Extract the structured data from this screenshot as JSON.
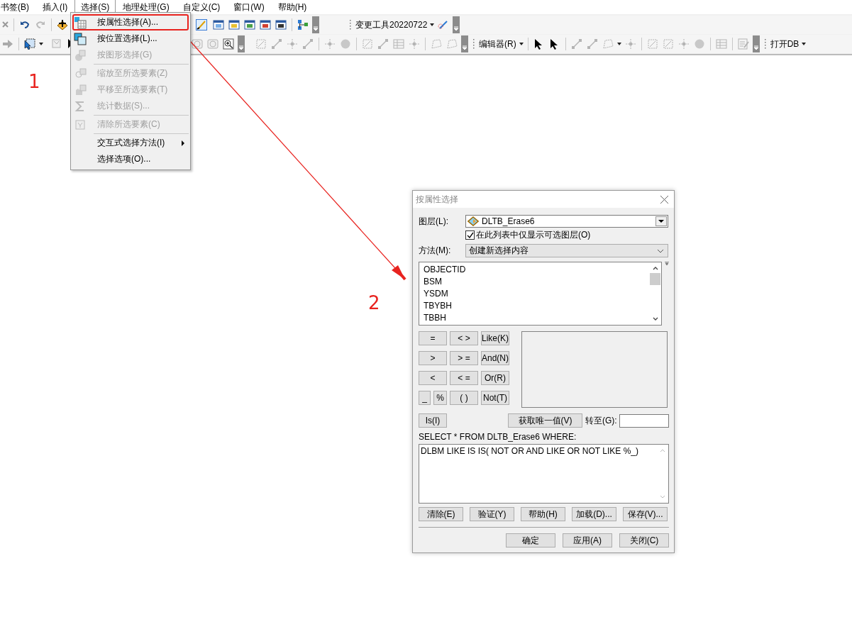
{
  "menubar": [
    {
      "label": "书签(B)",
      "selected": false
    },
    {
      "label": "插入(I)",
      "selected": false
    },
    {
      "label": "选择(S)",
      "selected": true
    },
    {
      "label": "地理处理(G)",
      "selected": false
    },
    {
      "label": "自定义(C)",
      "selected": false
    },
    {
      "label": "窗口(W)",
      "selected": false
    },
    {
      "label": "帮助(H)",
      "selected": false
    }
  ],
  "toolbar": {
    "tool_menu": "变更工具20220722",
    "editor_menu": "编辑器(R)",
    "db_menu": "打开DB"
  },
  "menu": {
    "items": [
      {
        "kind": "item",
        "label": "按属性选择(A)...",
        "disabled": false,
        "highlighted": true
      },
      {
        "kind": "item",
        "label": "按位置选择(L)...",
        "disabled": false,
        "highlighted": false
      },
      {
        "kind": "item",
        "label": "按图形选择(G)",
        "disabled": true,
        "highlighted": false
      },
      {
        "kind": "separator"
      },
      {
        "kind": "item",
        "label": "缩放至所选要素(Z)",
        "disabled": true,
        "highlighted": false
      },
      {
        "kind": "item",
        "label": "平移至所选要素(T)",
        "disabled": true,
        "highlighted": false
      },
      {
        "kind": "item",
        "label": "统计数据(S)...",
        "disabled": true,
        "highlighted": false
      },
      {
        "kind": "separator"
      },
      {
        "kind": "item",
        "label": "清除所选要素(C)",
        "disabled": true,
        "highlighted": false
      },
      {
        "kind": "separator"
      },
      {
        "kind": "submenu",
        "label": "交互式选择方法(I)",
        "disabled": false,
        "highlighted": false
      },
      {
        "kind": "item",
        "label": "选择选项(O)...",
        "disabled": false,
        "highlighted": false
      }
    ]
  },
  "annotations": [
    {
      "label": "1"
    },
    {
      "label": "2"
    }
  ],
  "dialog": {
    "title": "按属性选择",
    "layer_label": "图层(L):",
    "layer_value": "DLTB_Erase6",
    "only_selectable": {
      "label": "在此列表中仅显示可选图层(O)",
      "checked": true
    },
    "method_label": "方法(M):",
    "method_value": "创建新选择内容",
    "fields": [
      "OBJECTID",
      "BSM",
      "YSDM",
      "TBYBH",
      "TBBH"
    ],
    "operators": [
      [
        "=",
        "< >",
        "Like(K)"
      ],
      [
        ">",
        "> =",
        "And(N)"
      ],
      [
        "<",
        "< =",
        "Or(R)"
      ],
      [
        "_",
        "%",
        "( )",
        "Not(T)"
      ]
    ],
    "is_button": "Is(I)",
    "unique_button": "获取唯一值(V)",
    "goto_label": "转至(G):",
    "sql_label": "SELECT * FROM DLTB_Erase6 WHERE:",
    "sql_text": "DLBM LIKE IS IS( NOT OR AND LIKE OR NOT LIKE %_)",
    "tool_buttons": [
      "清除(E)",
      "验证(Y)",
      "帮助(H)",
      "加载(D)...",
      "保存(V)..."
    ],
    "footer_buttons": [
      "确定",
      "应用(A)",
      "关闭(C)"
    ]
  }
}
